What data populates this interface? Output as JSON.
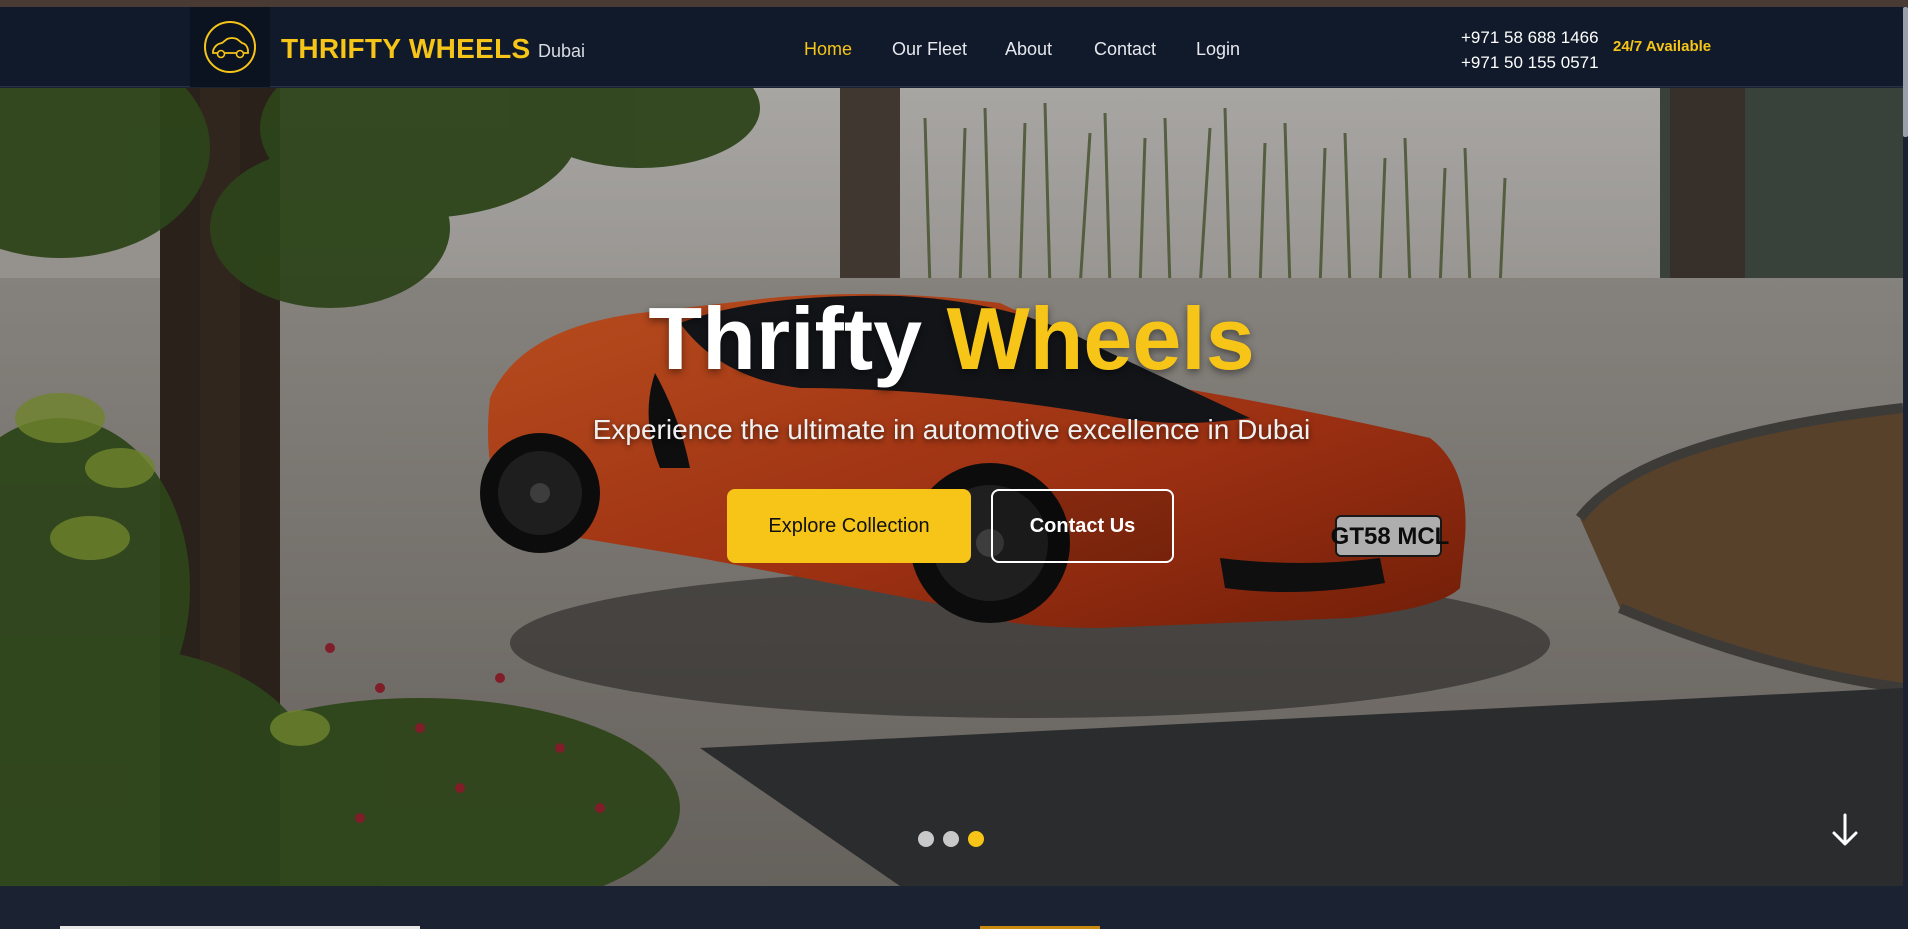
{
  "header": {
    "brand": "THRIFTY WHEELS",
    "brand_sub": "Dubai",
    "nav": [
      {
        "label": "Home",
        "active": true
      },
      {
        "label": "Our Fleet",
        "active": false
      },
      {
        "label": "About",
        "active": false
      },
      {
        "label": "Contact",
        "active": false
      },
      {
        "label": "Login",
        "active": false
      }
    ],
    "phones": [
      "+971 58 688 1466",
      "+971 50 155 0571"
    ],
    "availability": "24/7 Available",
    "logo_icon": "car-icon"
  },
  "hero": {
    "title_part1": "Thrifty",
    "title_part2": "Wheels",
    "subtitle": "Experience the ultimate in automotive excellence in Dubai",
    "plate": "GT58 MCL",
    "primary_button": "Explore Collection",
    "secondary_button": "Contact Us",
    "slides": {
      "count": 3,
      "active_index": 2
    },
    "scroll_icon": "arrow-down-icon"
  },
  "colors": {
    "accent": "#f6c518",
    "navbar_bg": "#111a2b",
    "page_bg": "#1b2332",
    "car": "#d8431a"
  }
}
